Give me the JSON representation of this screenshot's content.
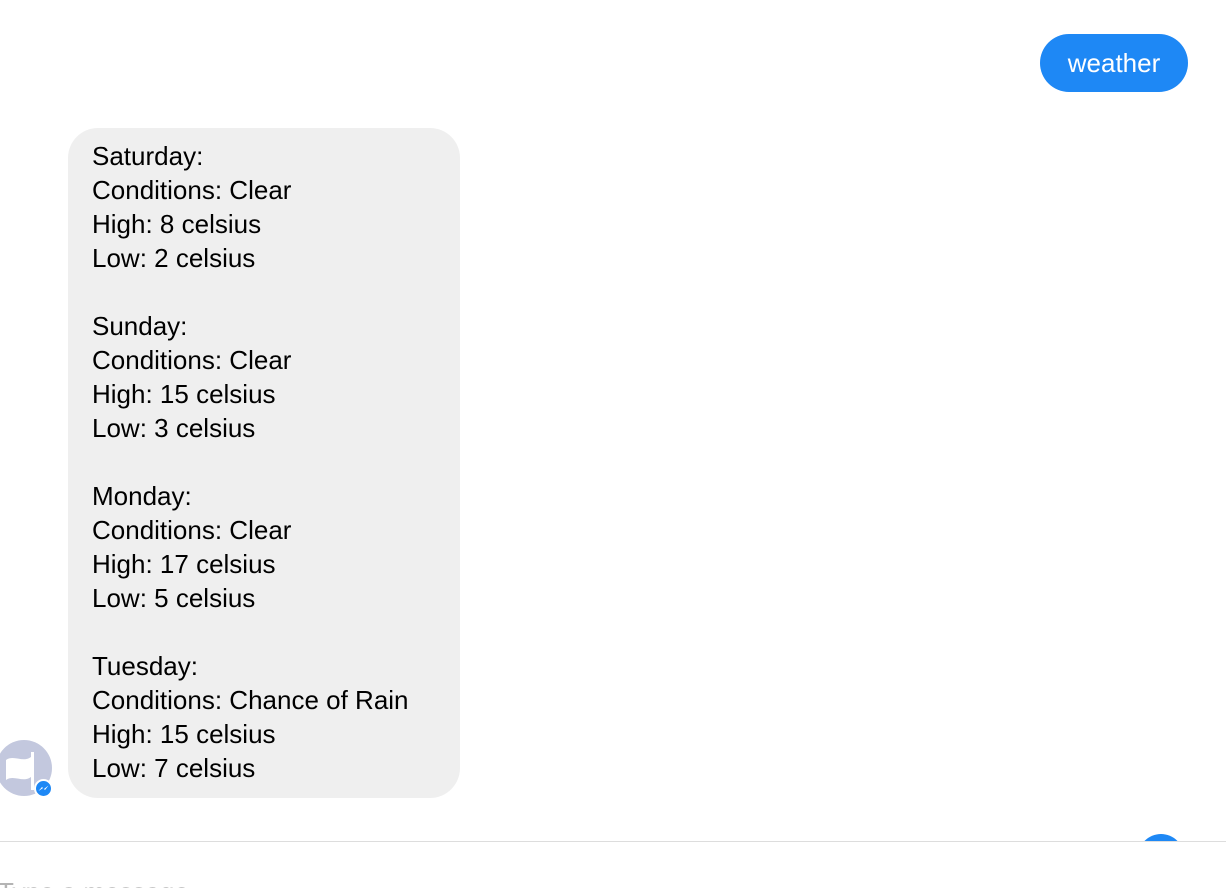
{
  "conversation": {
    "sent_message": "weather",
    "forecast": [
      {
        "day": "Saturday:",
        "conditions": "Conditions: Clear",
        "high": "High: 8 celsius",
        "low": "Low: 2 celsius"
      },
      {
        "day": "Sunday:",
        "conditions": "Conditions: Clear",
        "high": "High: 15 celsius",
        "low": "Low: 3 celsius"
      },
      {
        "day": "Monday:",
        "conditions": "Conditions: Clear",
        "high": "High: 17 celsius",
        "low": "Low: 5 celsius"
      },
      {
        "day": "Tuesday:",
        "conditions": "Conditions: Chance of Rain",
        "high": "High: 15 celsius",
        "low": "Low: 7 celsius"
      }
    ],
    "avatar_icon": "flag-icon",
    "avatar_badge_icon": "messenger-icon"
  },
  "composer": {
    "placeholder": "Type a message...",
    "value": "",
    "send_icon": "send-button-circle"
  },
  "colors": {
    "accent": "#1e88f5",
    "received_bubble": "#efefef",
    "avatar_bg": "#c3c8de",
    "placeholder_text": "#b4b4b4",
    "divider": "#dddddd"
  }
}
